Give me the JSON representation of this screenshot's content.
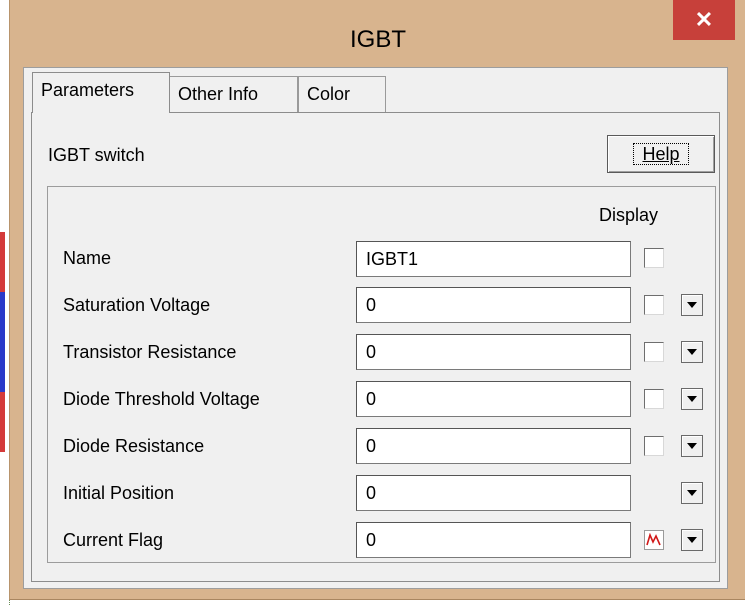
{
  "window": {
    "title": "IGBT",
    "close_symbol": "✕"
  },
  "tabs": [
    {
      "label": "Parameters",
      "active": true
    },
    {
      "label": "Other Info",
      "active": false
    },
    {
      "label": "Color",
      "active": false
    }
  ],
  "panel": {
    "heading": "IGBT switch",
    "help_label": "Help",
    "display_header": "Display"
  },
  "rows": [
    {
      "label": "Name",
      "value": "IGBT1",
      "display_checked": false,
      "has_dropdown": false
    },
    {
      "label": "Saturation Voltage",
      "value": "0",
      "display_checked": false,
      "has_dropdown": true
    },
    {
      "label": "Transistor Resistance",
      "value": "0",
      "display_checked": false,
      "has_dropdown": true
    },
    {
      "label": "Diode Threshold Voltage",
      "value": "0",
      "display_checked": false,
      "has_dropdown": true
    },
    {
      "label": "Diode Resistance",
      "value": "0",
      "display_checked": false,
      "has_dropdown": true
    },
    {
      "label": "Initial Position",
      "value": "0",
      "has_dropdown": true
    },
    {
      "label": "Current Flag",
      "value": "0",
      "flag_icon": "waveform-icon",
      "has_dropdown": true
    }
  ],
  "colors": {
    "title_bar": "#d8b48e",
    "close_button": "#c7403a",
    "dialog_bg": "#f0f0f0",
    "waveform": "#d11919"
  }
}
